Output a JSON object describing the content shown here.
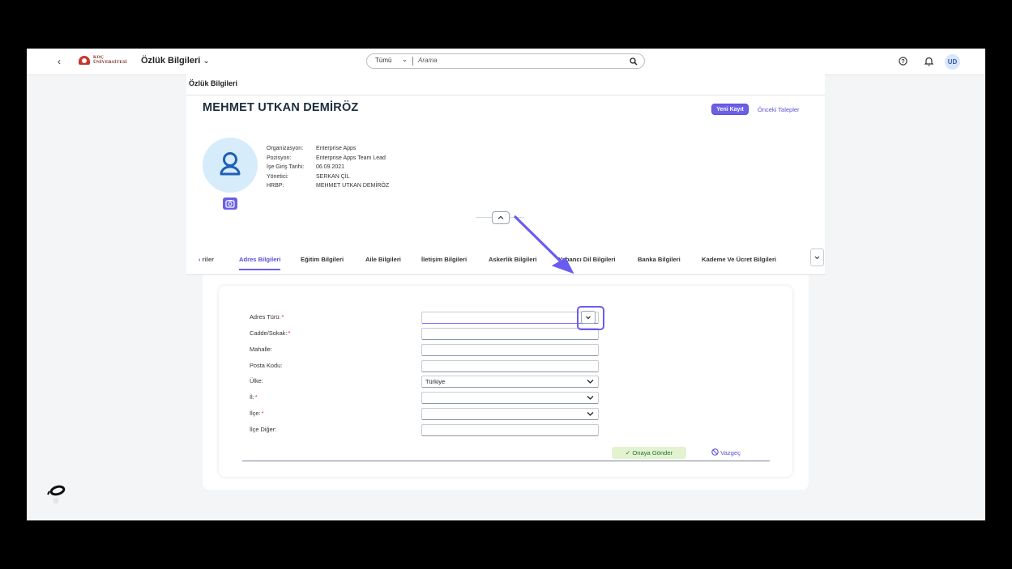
{
  "shellbar": {
    "logo_text_1": "KOÇ",
    "logo_text_2": "ÜNİVERSİTESİ",
    "app_title": "Özlük Bilgileri",
    "search_scope": "Tümü",
    "search_placeholder": "Arama",
    "user_initials": "UD"
  },
  "page": {
    "header_title": "Özlük Bilgileri",
    "employee_name": "MEHMET UTKAN DEMİRÖZ",
    "actions": {
      "new_record": "Yeni Kayıt",
      "previous_requests": "Önceki Talepler"
    },
    "info": [
      {
        "label": "Organizasyon:",
        "value": "Enterprise Apps"
      },
      {
        "label": "Pozisyon:",
        "value": "Enterprise Apps Team Lead"
      },
      {
        "label": "İşe Giriş Tarihi:",
        "value": "06.09.2021"
      },
      {
        "label": "Yönetici:",
        "value": "SERKAN ÇİL"
      },
      {
        "label": "HRBP:",
        "value": "MEHMET UTKAN DEMİRÖZ"
      }
    ]
  },
  "tabs": [
    {
      "label": "riler"
    },
    {
      "label": "Adres Bilgileri"
    },
    {
      "label": "Eğitim Bilgileri"
    },
    {
      "label": "Aile Bilgileri"
    },
    {
      "label": "İletişim Bilgileri"
    },
    {
      "label": "Askerlik Bilgileri"
    },
    {
      "label": "Yabancı Dil Bilgileri"
    },
    {
      "label": "Banka Bilgileri"
    },
    {
      "label": "Kademe Ve Ücret Bilgileri"
    }
  ],
  "form": {
    "fields": [
      {
        "label": "Adres Türü:",
        "required": "*",
        "value": ""
      },
      {
        "label": "Cadde/Sokak:",
        "required": "*",
        "value": ""
      },
      {
        "label": "Mahalle:",
        "required": "",
        "value": ""
      },
      {
        "label": "Posta Kodu:",
        "required": "",
        "value": ""
      },
      {
        "label": "Ülke:",
        "required": "",
        "value": "Türkiye"
      },
      {
        "label": "İl:",
        "required": "*",
        "value": ""
      },
      {
        "label": "İlçe:",
        "required": "*",
        "value": ""
      },
      {
        "label": "İlçe Diğer:",
        "required": "",
        "value": ""
      }
    ],
    "submit_label": "Onaya Gönder",
    "cancel_label": "Vazgeç"
  }
}
